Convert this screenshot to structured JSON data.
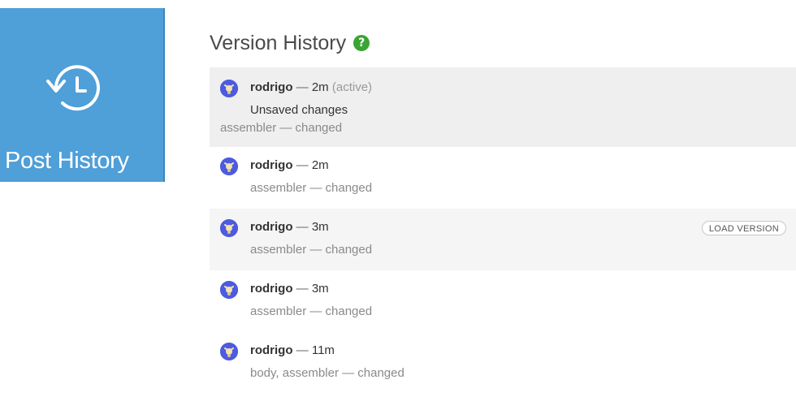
{
  "tile": {
    "icon": "history-clock-icon",
    "label": "Post History",
    "color": "#4f9fd8"
  },
  "panel": {
    "title": "Version History",
    "help_icon": "?"
  },
  "versions": [
    {
      "user": "rodrigo",
      "separator": "—",
      "time": "2m",
      "state": "(active)",
      "note": "Unsaved changes",
      "changes": "assembler — changed"
    },
    {
      "user": "rodrigo",
      "separator": "—",
      "time": "2m",
      "changes": "assembler — changed"
    },
    {
      "user": "rodrigo",
      "separator": "—",
      "time": "3m",
      "changes": "assembler — changed",
      "action": "LOAD VERSION"
    },
    {
      "user": "rodrigo",
      "separator": "—",
      "time": "3m",
      "changes": "assembler — changed"
    },
    {
      "user": "rodrigo",
      "separator": "—",
      "time": "11m",
      "changes": "body, assembler — changed"
    }
  ],
  "colors": {
    "accent": "#4f9fd8",
    "avatar": "#4c5be0",
    "help": "#3aa534",
    "active_row": "#efefef"
  }
}
